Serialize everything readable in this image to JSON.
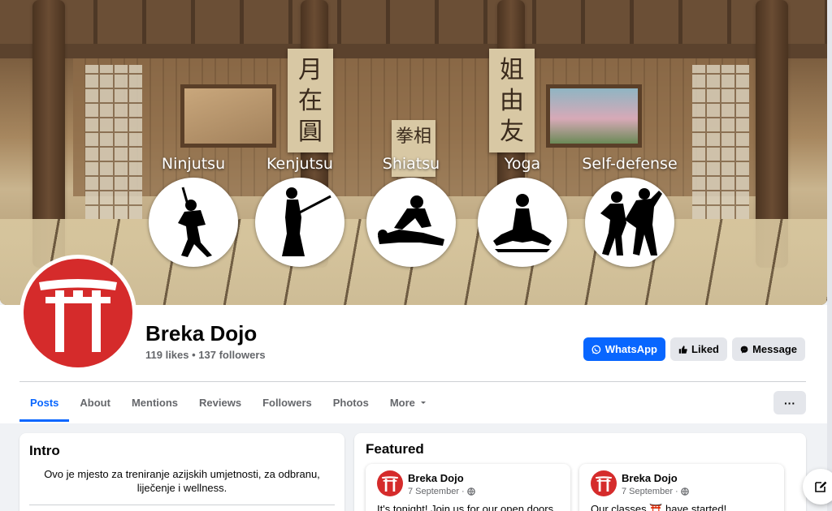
{
  "cover": {
    "scroll_left": "月在圓",
    "scroll_center": "拳相",
    "scroll_right": "姐由友",
    "activities": [
      {
        "label": "Ninjutsu",
        "icon": "ninja-silhouette-icon"
      },
      {
        "label": "Kenjutsu",
        "icon": "swordsman-silhouette-icon"
      },
      {
        "label": "Shiatsu",
        "icon": "massage-silhouette-icon"
      },
      {
        "label": "Yoga",
        "icon": "meditation-silhouette-icon"
      },
      {
        "label": "Self-defense",
        "icon": "self-defense-silhouette-icon"
      }
    ]
  },
  "profile": {
    "name": "Breka Dojo",
    "stats": "119 likes • 137 followers",
    "avatar_icon": "torii-gate-icon",
    "brand_color": "#d52b2b"
  },
  "actions": {
    "whatsapp": "WhatsApp",
    "liked": "Liked",
    "message": "Message",
    "more": "···"
  },
  "tabs": [
    "Posts",
    "About",
    "Mentions",
    "Reviews",
    "Followers",
    "Photos",
    "More"
  ],
  "intro": {
    "title": "Intro",
    "text": "Ovo je mjesto za treniranje azijskih umjetnosti, za odbranu, liječenje i wellness."
  },
  "featured": {
    "title": "Featured",
    "posts": [
      {
        "author": "Breka Dojo",
        "date": "7 September ·",
        "text": "It's tonight! Join us for our open doors"
      },
      {
        "author": "Breka Dojo",
        "date": "7 September ·",
        "text": "Our classes ⛩️ have started!"
      }
    ]
  },
  "colors": {
    "accent": "#0866ff",
    "secondary_bg": "#e4e6eb",
    "muted_text": "#65676b"
  }
}
